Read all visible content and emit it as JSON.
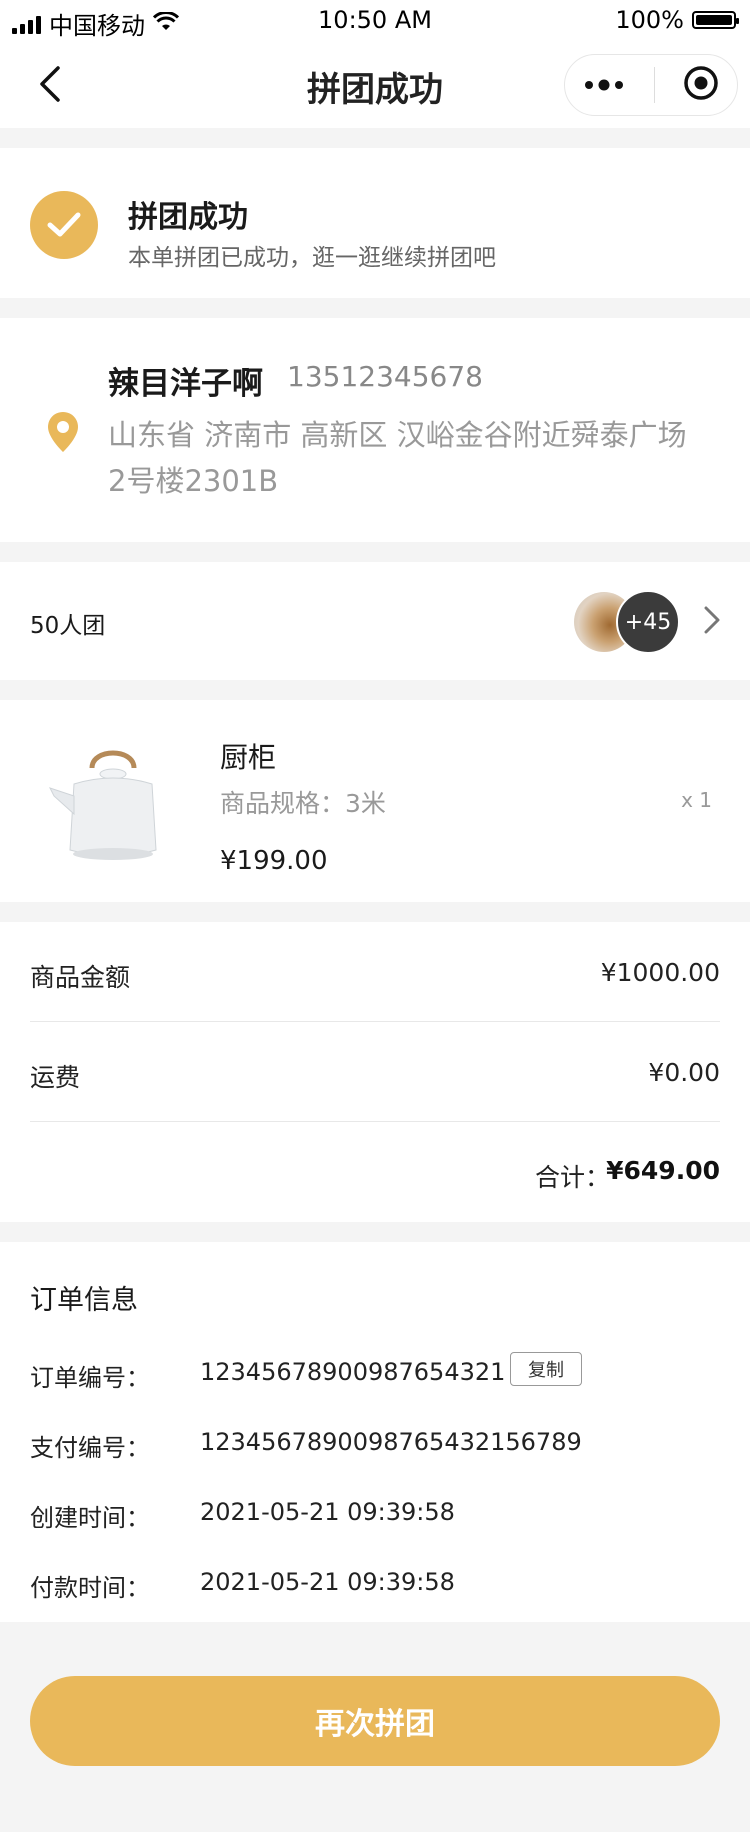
{
  "status_bar": {
    "carrier": "中国移动",
    "time": "10:50 AM",
    "battery": "100%"
  },
  "nav": {
    "title": "拼团成功"
  },
  "success": {
    "title": "拼团成功",
    "subtitle": "本单拼团已成功，逛一逛继续拼团吧"
  },
  "address": {
    "name": "辣目洋子啊",
    "phone": "13512345678",
    "detail": "山东省 济南市 高新区 汉峪金谷附近舜泰广场2号楼2301B"
  },
  "group": {
    "label": "50人团",
    "more_count": "+45"
  },
  "product": {
    "name": "厨柜",
    "spec": "商品规格：3米",
    "qty": "x 1",
    "price": "¥199.00"
  },
  "amount": {
    "goods_label": "商品金额",
    "goods_value": "¥1000.00",
    "shipping_label": "运费",
    "shipping_value": "¥0.00",
    "total_label": "合计：",
    "total_value": "¥649.00"
  },
  "order_info": {
    "title": "订单信息",
    "order_no_label": "订单编号：",
    "order_no": "12345678900987654321",
    "copy_label": "复制",
    "pay_no_label": "支付编号：",
    "pay_no": "1234567890098765432156789",
    "created_label": "创建时间：",
    "created": "2021-05-21 09:39:58",
    "paid_label": "付款时间：",
    "paid": "2021-05-21 09:39:58"
  },
  "cta": {
    "label": "再次拼团"
  },
  "colors": {
    "accent": "#e9b85a"
  },
  "icons": [
    "back-arrow-icon",
    "more-dots-icon",
    "target-icon",
    "check-icon",
    "location-pin-icon",
    "chevron-right-icon",
    "wifi-icon",
    "signal-icon",
    "battery-icon"
  ]
}
